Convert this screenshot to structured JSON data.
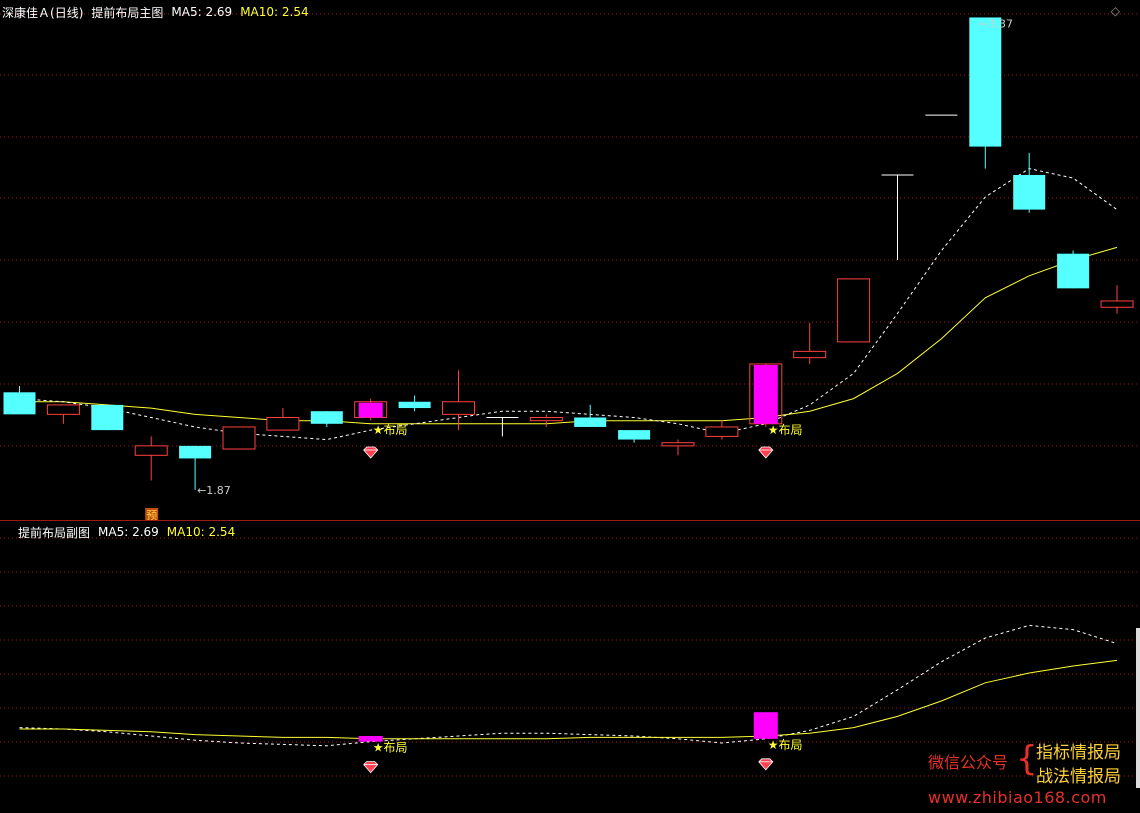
{
  "main": {
    "stock_name": "深康佳Ａ",
    "period": "(日线)",
    "indicator": "提前布局主图",
    "ma5_label": "MA5: 2.69",
    "ma10_label": "MA10: 2.54",
    "high_label": "3.37",
    "low_label": "1.87",
    "pre_badge": "预",
    "signal_text": "★布局",
    "diamond_icon": "◇"
  },
  "sub": {
    "indicator": "提前布局副图",
    "ma5_label": "MA5: 2.69",
    "ma10_label": "MA10: 2.54",
    "signal_text": "★布局"
  },
  "watermark": {
    "wechat": "微信公众号",
    "brace": "{",
    "line1": "指标情报局",
    "line2": "战法情报局",
    "url": "www.zhibiao168.com"
  },
  "colors": {
    "up": "#ff4040",
    "down": "#55ffff",
    "signal": "#ff00ff",
    "ma5": "#ffffff",
    "ma10": "#ffff33",
    "grid": "#a01818"
  },
  "chart_data": [
    {
      "type": "candlestick",
      "title": "提前布局主图",
      "ylim": [
        1.75,
        3.45
      ],
      "x": [
        1,
        2,
        3,
        4,
        5,
        6,
        7,
        8,
        9,
        10,
        11,
        12,
        13,
        14,
        15,
        16,
        17,
        18,
        19,
        20,
        21,
        22,
        23,
        24,
        25,
        26
      ],
      "candles": [
        {
          "o": 2.18,
          "h": 2.2,
          "l": 2.11,
          "c": 2.11
        },
        {
          "o": 2.11,
          "h": 2.14,
          "l": 2.08,
          "c": 2.14
        },
        {
          "o": 2.14,
          "h": 2.14,
          "l": 2.06,
          "c": 2.06
        },
        {
          "o": 1.98,
          "h": 2.04,
          "l": 1.9,
          "c": 2.01
        },
        {
          "o": 2.01,
          "h": 2.01,
          "l": 1.87,
          "c": 1.97
        },
        {
          "o": 2.0,
          "h": 2.07,
          "l": 2.0,
          "c": 2.07
        },
        {
          "o": 2.06,
          "h": 2.13,
          "l": 2.06,
          "c": 2.1
        },
        {
          "o": 2.12,
          "h": 2.12,
          "l": 2.07,
          "c": 2.08
        },
        {
          "o": 2.1,
          "h": 2.16,
          "l": 2.09,
          "c": 2.15,
          "signal": true
        },
        {
          "o": 2.15,
          "h": 2.17,
          "l": 2.12,
          "c": 2.13
        },
        {
          "o": 2.11,
          "h": 2.25,
          "l": 2.06,
          "c": 2.15
        },
        {
          "o": 2.1,
          "h": 2.1,
          "l": 2.04,
          "c": 2.1
        },
        {
          "o": 2.09,
          "h": 2.11,
          "l": 2.07,
          "c": 2.1
        },
        {
          "o": 2.1,
          "h": 2.14,
          "l": 2.07,
          "c": 2.07
        },
        {
          "o": 2.06,
          "h": 2.06,
          "l": 2.02,
          "c": 2.03
        },
        {
          "o": 2.01,
          "h": 2.03,
          "l": 1.98,
          "c": 2.02
        },
        {
          "o": 2.04,
          "h": 2.09,
          "l": 2.03,
          "c": 2.07
        },
        {
          "o": 2.08,
          "h": 2.27,
          "l": 2.07,
          "c": 2.27,
          "signal": true
        },
        {
          "o": 2.29,
          "h": 2.4,
          "l": 2.27,
          "c": 2.31
        },
        {
          "o": 2.34,
          "h": 2.54,
          "l": 2.34,
          "c": 2.54
        },
        {
          "o": 2.87,
          "h": 2.87,
          "l": 2.6,
          "c": 2.87
        },
        {
          "o": 3.06,
          "h": 3.06,
          "l": 3.06,
          "c": 3.06
        },
        {
          "o": 3.37,
          "h": 3.37,
          "l": 2.89,
          "c": 2.96
        },
        {
          "o": 2.87,
          "h": 2.94,
          "l": 2.75,
          "c": 2.76
        },
        {
          "o": 2.62,
          "h": 2.63,
          "l": 2.51,
          "c": 2.51
        },
        {
          "o": 2.45,
          "h": 2.52,
          "l": 2.43,
          "c": 2.47
        }
      ],
      "ma5": [
        2.16,
        2.15,
        2.13,
        2.1,
        2.07,
        2.05,
        2.04,
        2.03,
        2.06,
        2.08,
        2.1,
        2.12,
        2.12,
        2.11,
        2.1,
        2.08,
        2.05,
        2.08,
        2.14,
        2.24,
        2.43,
        2.63,
        2.8,
        2.89,
        2.86,
        2.76
      ],
      "ma10": [
        2.15,
        2.15,
        2.14,
        2.13,
        2.11,
        2.1,
        2.09,
        2.09,
        2.08,
        2.08,
        2.08,
        2.08,
        2.08,
        2.09,
        2.09,
        2.09,
        2.09,
        2.1,
        2.12,
        2.16,
        2.24,
        2.35,
        2.48,
        2.55,
        2.6,
        2.64
      ],
      "signals": [
        9,
        18
      ],
      "annotations": [
        "3.37",
        "1.87",
        "预"
      ]
    },
    {
      "type": "line",
      "title": "提前布局副图",
      "ylim": [
        1.75,
        3.45
      ],
      "x": [
        1,
        2,
        3,
        4,
        5,
        6,
        7,
        8,
        9,
        10,
        11,
        12,
        13,
        14,
        15,
        16,
        17,
        18,
        19,
        20,
        21,
        22,
        23,
        24,
        25,
        26
      ],
      "series": [
        {
          "name": "MA5",
          "style": "dashed",
          "values": [
            2.16,
            2.15,
            2.13,
            2.1,
            2.07,
            2.05,
            2.04,
            2.03,
            2.06,
            2.08,
            2.1,
            2.12,
            2.12,
            2.11,
            2.1,
            2.08,
            2.05,
            2.08,
            2.14,
            2.24,
            2.43,
            2.63,
            2.8,
            2.89,
            2.86,
            2.76
          ]
        },
        {
          "name": "MA10",
          "style": "solid",
          "values": [
            2.15,
            2.15,
            2.14,
            2.13,
            2.11,
            2.1,
            2.09,
            2.09,
            2.08,
            2.08,
            2.08,
            2.08,
            2.08,
            2.09,
            2.09,
            2.09,
            2.09,
            2.1,
            2.12,
            2.16,
            2.24,
            2.35,
            2.48,
            2.55,
            2.6,
            2.64
          ]
        }
      ],
      "bars": [
        {
          "x": 9,
          "from": 2.06,
          "to": 2.1
        },
        {
          "x": 18,
          "from": 2.08,
          "to": 2.27
        }
      ]
    }
  ]
}
